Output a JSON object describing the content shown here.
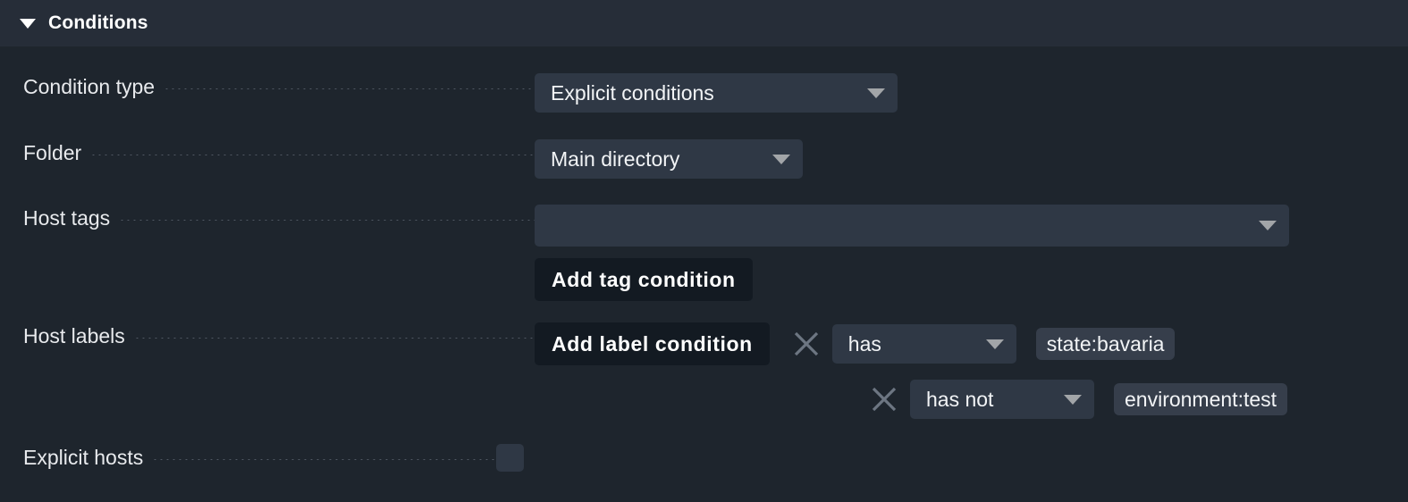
{
  "section": {
    "title": "Conditions",
    "collapse_icon": "triangle-down-icon",
    "expanded": true
  },
  "colors": {
    "header_bg": "#262d38",
    "body_bg": "#1e252d",
    "field_bg": "#2f3845",
    "button_bg": "#131a22",
    "chip_bg": "#363e4b",
    "text": "#f2f4f6",
    "caret": "#a2a5a8",
    "leader_dots": "#7b838f",
    "delete_icon": "#6d7682"
  },
  "rows": {
    "condition_type": {
      "label": "Condition type",
      "select": {
        "value": "Explicit conditions",
        "caret_icon": "chevron-down-icon"
      }
    },
    "folder": {
      "label": "Folder",
      "select": {
        "value": "Main directory",
        "caret_icon": "chevron-down-icon"
      }
    },
    "host_tags": {
      "label": "Host tags",
      "select": {
        "value": "",
        "placeholder": "",
        "caret_icon": "chevron-down-icon"
      },
      "add_button": "Add tag condition"
    },
    "host_labels": {
      "label": "Host labels",
      "add_button": "Add label condition",
      "conditions": [
        {
          "delete_icon": "close-x-icon",
          "operator": "has",
          "caret_icon": "chevron-down-icon",
          "label_value": "state:bavaria"
        },
        {
          "delete_icon": "close-x-icon",
          "operator": "has not",
          "caret_icon": "chevron-down-icon",
          "label_value": "environment:test"
        }
      ]
    },
    "explicit_hosts": {
      "label": "Explicit hosts",
      "checkbox_checked": false
    }
  }
}
